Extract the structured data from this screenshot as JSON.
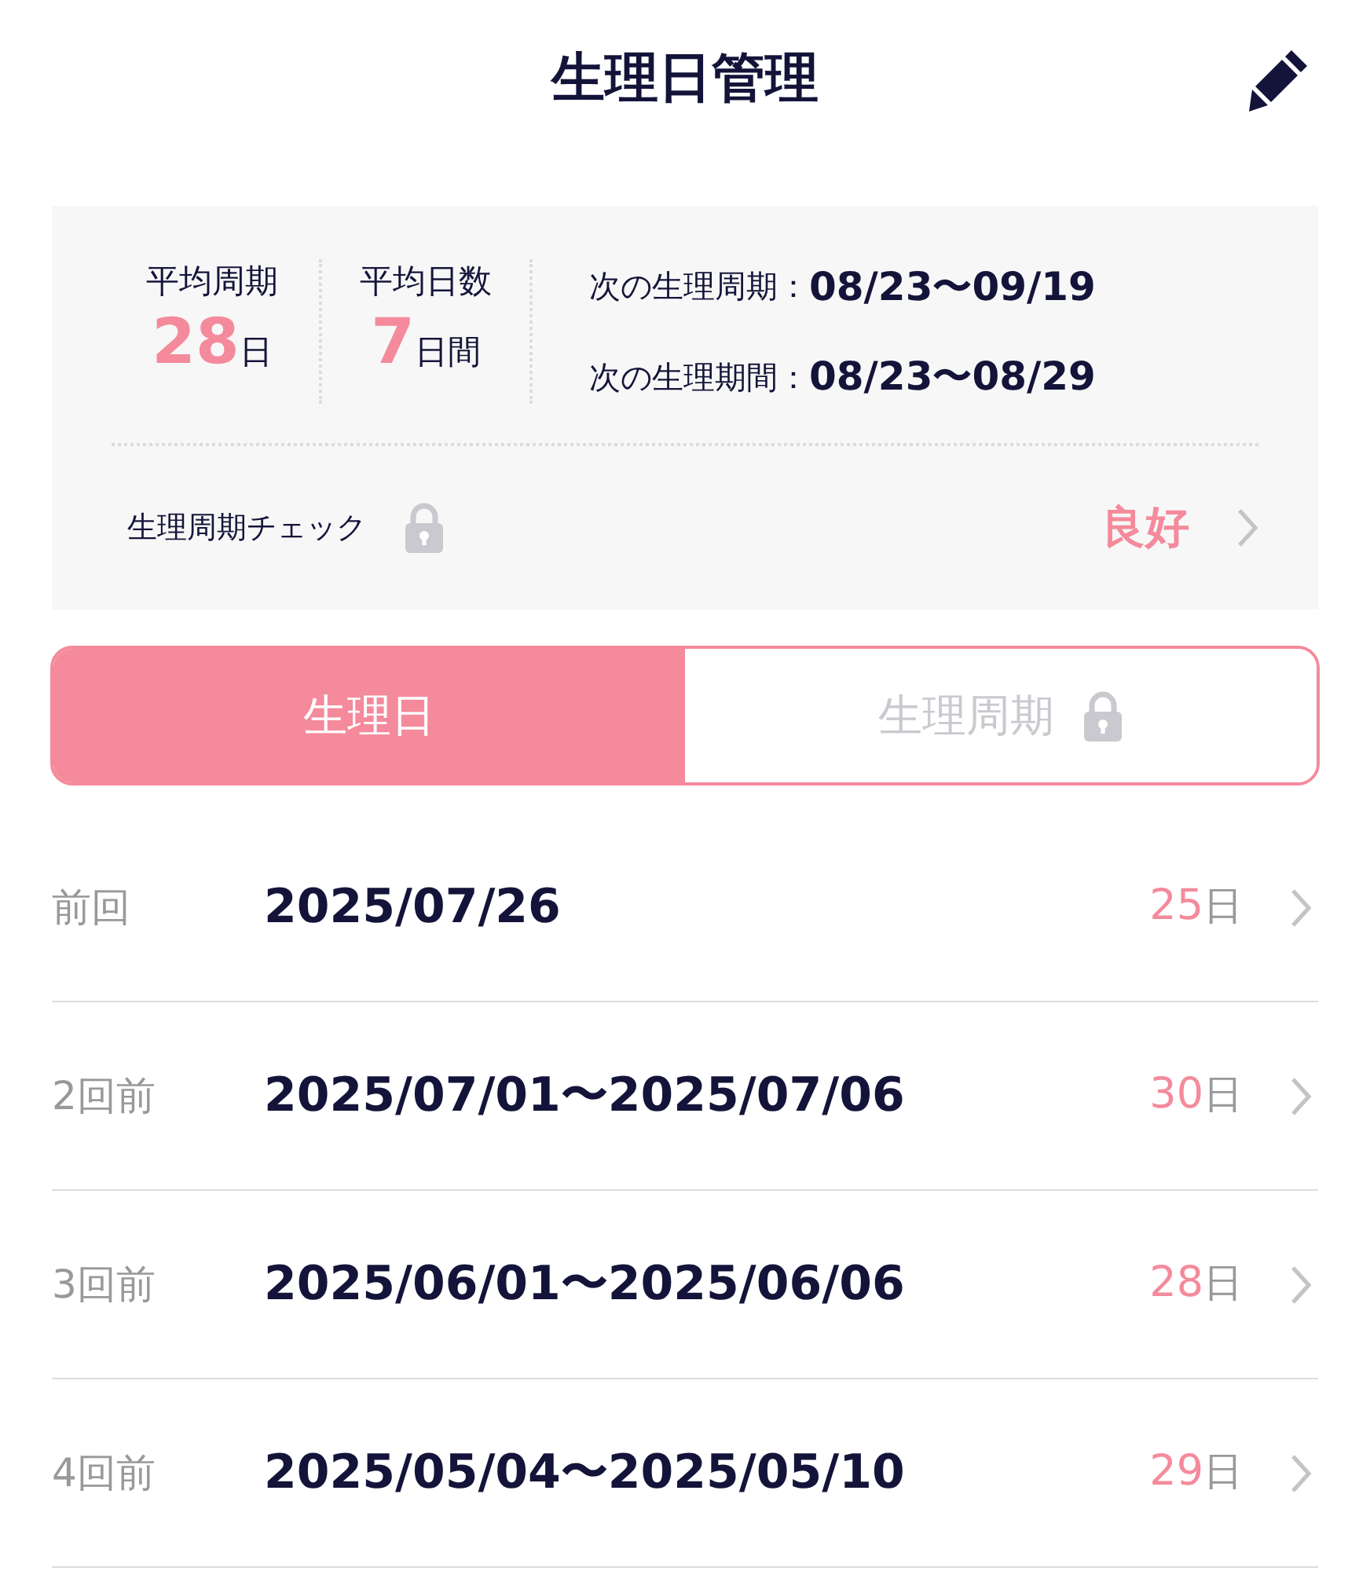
{
  "header": {
    "title": "生理日管理"
  },
  "summary": {
    "stats": [
      {
        "label": "平均周期",
        "value": "28",
        "unit": "日"
      },
      {
        "label": "平均日数",
        "value": "7",
        "unit": "日間"
      }
    ],
    "next": [
      {
        "label": "次の生理周期",
        "separator": "：",
        "value": "08/23〜09/19"
      },
      {
        "label": "次の生理期間",
        "separator": "：",
        "value": "08/23〜08/29"
      }
    ],
    "check": {
      "label": "生理周期チェック",
      "locked": true,
      "result": "良好"
    }
  },
  "tabs": [
    {
      "label": "生理日",
      "selected": true,
      "locked": false
    },
    {
      "label": "生理周期",
      "selected": false,
      "locked": true
    }
  ],
  "records": [
    {
      "label": "前回",
      "dates": "2025/07/26",
      "days": "25",
      "unit": "日"
    },
    {
      "label": "2回前",
      "dates": "2025/07/01〜2025/07/06",
      "days": "30",
      "unit": "日"
    },
    {
      "label": "3回前",
      "dates": "2025/06/01〜2025/06/06",
      "days": "28",
      "unit": "日"
    },
    {
      "label": "4回前",
      "dates": "2025/05/04〜2025/05/10",
      "days": "29",
      "unit": "日"
    }
  ]
}
